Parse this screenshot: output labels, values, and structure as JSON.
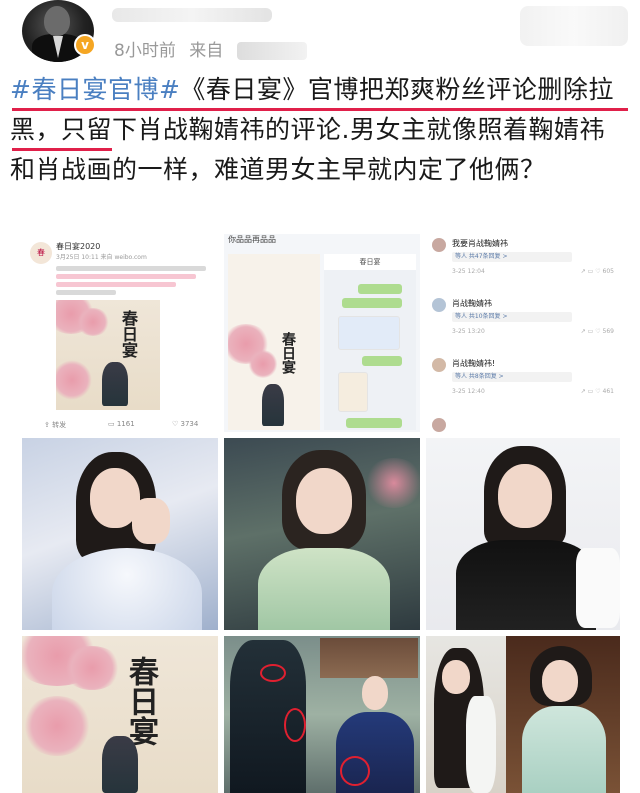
{
  "header": {
    "verify_badge": "v",
    "time": "8小时前",
    "source_label": "来自"
  },
  "post": {
    "hashtag": "#春日宴官博#",
    "body": "《春日宴》官博把郑爽粉丝评论删除拉黑，只留下肖战鞠婧祎的评论.男女主就像照着鞠婧祎和肖战画的一样，难道男女主早就内定了他俩？"
  },
  "shot1": {
    "account": "春日宴2020",
    "time": "3月25日 10:11 来自 weibo.com",
    "repost_label": "转发",
    "comments_count": "1161",
    "likes_count": "3734",
    "poster_title": "春日宴"
  },
  "shot2": {
    "top_title": "春日宴",
    "header_text": "你品品再品品"
  },
  "shot3": {
    "comments": [
      {
        "text": "我要肖战鞠婧祎",
        "sub": "等人 共47条回复 >",
        "time": "3-25 12:04",
        "likes": "605"
      },
      {
        "text": "肖战鞠婧祎",
        "sub": "等人 共10条回复 >",
        "time": "3-25 13:20",
        "likes": "569"
      },
      {
        "text": "肖战鞠婧祎!",
        "sub": "等人 共8条回复 >",
        "time": "3-25 12:40",
        "likes": "461"
      }
    ]
  },
  "poster2": {
    "title": "春日宴"
  },
  "colors": {
    "hashtag": "#4a7fc1",
    "underline": "#e0204a",
    "meta": "#999999"
  }
}
